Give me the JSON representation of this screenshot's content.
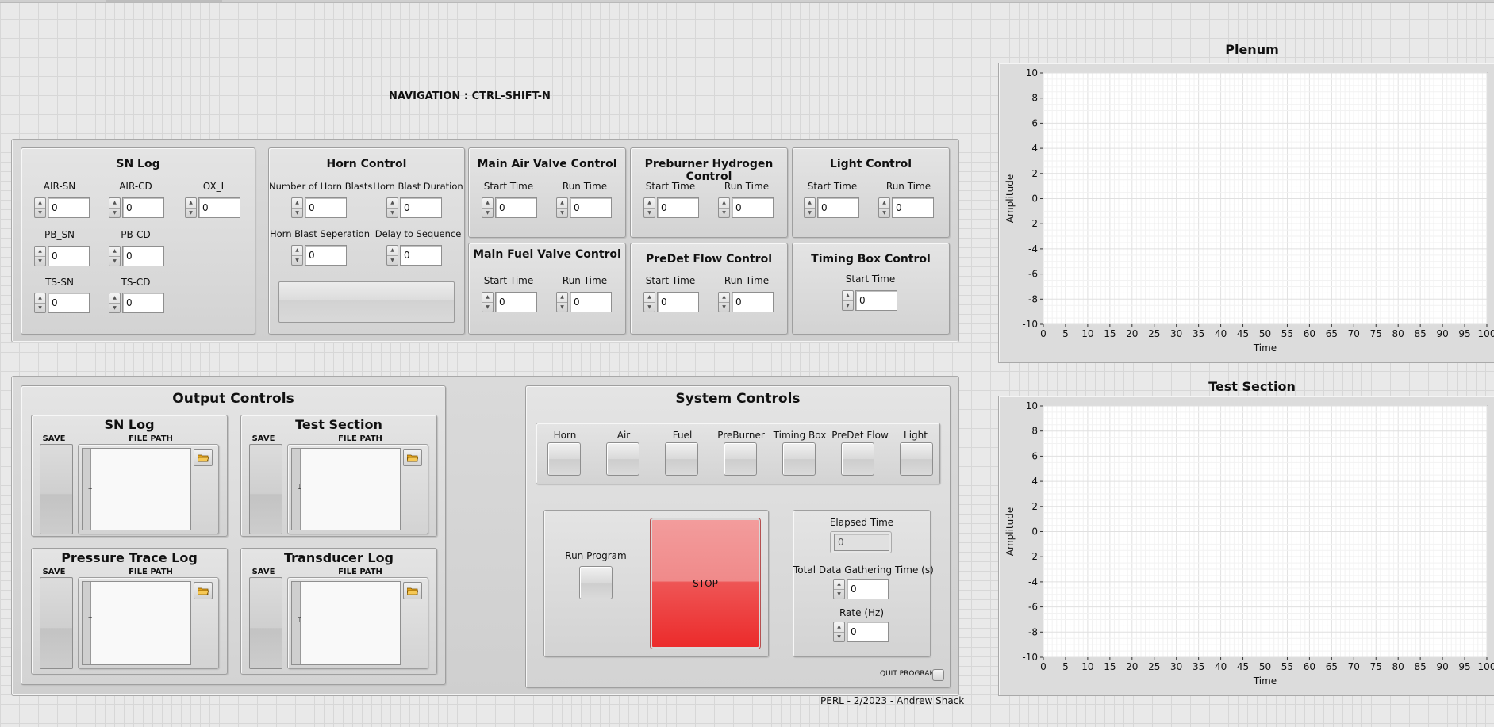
{
  "navigation_hint": "NAVIGATION : CTRL-SHIFT-N",
  "footer": "PERL - 2/2023 - Andrew Shack",
  "sn_log_panel": {
    "title": "SN Log",
    "fields": [
      {
        "label": "AIR-SN",
        "value": "0"
      },
      {
        "label": "AIR-CD",
        "value": "0"
      },
      {
        "label": "OX_I",
        "value": "0"
      },
      {
        "label": "PB_SN",
        "value": "0"
      },
      {
        "label": "PB-CD",
        "value": "0"
      },
      {
        "label": "TS-SN",
        "value": "0"
      },
      {
        "label": "TS-CD",
        "value": "0"
      }
    ]
  },
  "horn_control": {
    "title": "Horn Control",
    "fields": [
      {
        "label": "Number of Horn Blasts",
        "value": "0"
      },
      {
        "label": "Horn Blast Duration",
        "value": "0"
      },
      {
        "label": "Horn Blast Seperation",
        "value": "0"
      },
      {
        "label": "Delay to Sequence",
        "value": "0"
      }
    ]
  },
  "main_air_valve": {
    "title": "Main Air Valve Control",
    "start_label": "Start Time",
    "start_value": "0",
    "run_label": "Run Time",
    "run_value": "0"
  },
  "preburner_hydrogen": {
    "title": "Preburner Hydrogen Control",
    "start_label": "Start Time",
    "start_value": "0",
    "run_label": "Run Time",
    "run_value": "0"
  },
  "light_control": {
    "title": "Light Control",
    "start_label": "Start Time",
    "start_value": "0",
    "run_label": "Run Time",
    "run_value": "0"
  },
  "main_fuel_valve": {
    "title": "Main Fuel Valve Control",
    "start_label": "Start Time",
    "start_value": "0",
    "run_label": "Run Time",
    "run_value": "0"
  },
  "predet_flow": {
    "title": "PreDet Flow Control",
    "start_label": "Start Time",
    "start_value": "0",
    "run_label": "Run Time",
    "run_value": "0"
  },
  "timing_box": {
    "title": "Timing Box Control",
    "start_label": "Start Time",
    "start_value": "0"
  },
  "output_controls": {
    "title": "Output Controls",
    "save_label": "SAVE",
    "file_path_label": "FILE PATH",
    "logs": [
      {
        "title": "SN Log"
      },
      {
        "title": "Test Section"
      },
      {
        "title": "Pressure Trace Log"
      },
      {
        "title": "Transducer Log"
      }
    ]
  },
  "system_controls": {
    "title": "System Controls",
    "buttons": [
      "Horn",
      "Air",
      "Fuel",
      "PreBurner",
      "Timing Box",
      "PreDet Flow",
      "Light"
    ],
    "run_program_label": "Run Program",
    "stop_label": "STOP",
    "elapsed_time_label": "Elapsed Time",
    "elapsed_time_value": "0",
    "total_time_label": "Total Data Gathering Time (s)",
    "total_time_value": "0",
    "rate_label": "Rate (Hz)",
    "rate_value": "0",
    "quit_label": "QUIT PROGRAM"
  },
  "chart_data": [
    {
      "type": "line",
      "title": "Plenum",
      "xlabel": "Time",
      "ylabel": "Amplitude",
      "xlim": [
        0,
        100
      ],
      "ylim": [
        -10,
        10
      ],
      "x_ticks": [
        0,
        5,
        10,
        15,
        20,
        25,
        30,
        35,
        40,
        45,
        50,
        55,
        60,
        65,
        70,
        75,
        80,
        85,
        90,
        95,
        100
      ],
      "y_ticks": [
        10,
        8,
        6,
        4,
        2,
        0,
        -2,
        -4,
        -6,
        -8,
        -10
      ],
      "grid": true,
      "series": []
    },
    {
      "type": "line",
      "title": "Test Section",
      "xlabel": "Time",
      "ylabel": "Amplitude",
      "xlim": [
        0,
        100
      ],
      "ylim": [
        -10,
        10
      ],
      "x_ticks": [
        0,
        5,
        10,
        15,
        20,
        25,
        30,
        35,
        40,
        45,
        50,
        55,
        60,
        65,
        70,
        75,
        80,
        85,
        90,
        95,
        100
      ],
      "y_ticks": [
        10,
        8,
        6,
        4,
        2,
        0,
        -2,
        -4,
        -6,
        -8,
        -10
      ],
      "grid": true,
      "series": []
    }
  ]
}
